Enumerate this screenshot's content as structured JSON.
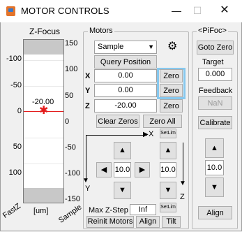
{
  "window": {
    "title": "MOTOR CONTROLS",
    "min": "—",
    "max": "☐",
    "close": "✕"
  },
  "zfocus": {
    "title": "Z-Focus",
    "left_ticks": [
      "-100",
      "-50",
      "0",
      "50",
      "100"
    ],
    "right_ticks": [
      "150",
      "100",
      "50",
      "0",
      "-50",
      "-100",
      "-150"
    ],
    "current_value": "-20.00",
    "unit_label": "[um]",
    "label_fast": "FastZ",
    "label_sample": "Sample"
  },
  "motors": {
    "title": "Motors",
    "select_value": "Sample",
    "gear_icon": "⚙",
    "query_label": "Query Position",
    "axes": [
      {
        "label": "X",
        "value": "0.00",
        "zero": "Zero"
      },
      {
        "label": "Y",
        "value": "0.00",
        "zero": "Zero"
      },
      {
        "label": "Z",
        "value": "-20.00",
        "zero": "Zero"
      }
    ],
    "clear_zeros": "Clear Zeros",
    "zero_all": "Zero All",
    "setlim": "SetLim",
    "axis_x": "X",
    "axis_y": "Y",
    "axis_z": "Z",
    "step_xy": "10.0",
    "step_z": "10.0",
    "max_zstep_label": "Max Z-Step",
    "max_zstep_value": "Inf",
    "reinit": "Reinit Motors",
    "align": "Align",
    "tilt": "Tilt",
    "up": "▲",
    "down": "▼",
    "left": "◀",
    "right": "▶"
  },
  "pifoc": {
    "title": "<PiFoc>",
    "goto_zero": "Goto Zero",
    "target_label": "Target",
    "target_value": "0.000",
    "feedback_label": "Feedback",
    "feedback_value": "NaN",
    "calibrate": "Calibrate",
    "step": "10.0",
    "align": "Align",
    "up": "▲",
    "down": "▼"
  },
  "colors": {
    "highlight": "#86c8ee",
    "marker": "#e31b1b",
    "scale_gray": "#c8c8c8"
  }
}
